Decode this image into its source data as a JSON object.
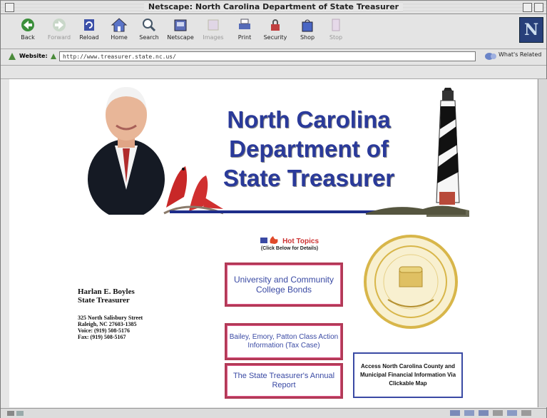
{
  "window": {
    "title": "Netscape: North Carolina Department of State Treasurer"
  },
  "toolbar": {
    "buttons": [
      {
        "label": "Back",
        "enabled": true
      },
      {
        "label": "Forward",
        "enabled": false
      },
      {
        "label": "Reload",
        "enabled": true
      },
      {
        "label": "Home",
        "enabled": true
      },
      {
        "label": "Search",
        "enabled": true
      },
      {
        "label": "Netscape",
        "enabled": true
      },
      {
        "label": "Images",
        "enabled": false
      },
      {
        "label": "Print",
        "enabled": true
      },
      {
        "label": "Security",
        "enabled": true
      },
      {
        "label": "Shop",
        "enabled": true
      },
      {
        "label": "Stop",
        "enabled": false
      }
    ],
    "logo_letter": "N"
  },
  "location": {
    "label": "Website:",
    "url": "http://www.treasurer.state.nc.us/",
    "related": "What's Related"
  },
  "page": {
    "heading": [
      "North Carolina",
      "Department of",
      "State Treasurer"
    ],
    "hot_topics": {
      "title": "Hot Topics",
      "hint": "(Click Below for Details)"
    },
    "links": [
      {
        "text": "University and Community College Bonds"
      },
      {
        "text": "Bailey, Emory, Patton Class Action Information (Tax Case)"
      },
      {
        "text": "The State Treasurer's Annual Report"
      }
    ],
    "map_link": {
      "text": "Access North Carolina County and Municipal Financial Information Via Clickable Map"
    },
    "treasurer": {
      "name": "Harlan E. Boyles",
      "title": "State Treasurer",
      "address": [
        "325 North Salisbury Street",
        "Raleigh, NC 27603-1385",
        "Voice: (919) 508-5176",
        "Fax: (919) 508-5167"
      ]
    }
  },
  "colors": {
    "heading": "#2a3a9a",
    "link_border": "#b23a56",
    "link_text": "#3a4aa4",
    "seal": "#d8b64a"
  }
}
